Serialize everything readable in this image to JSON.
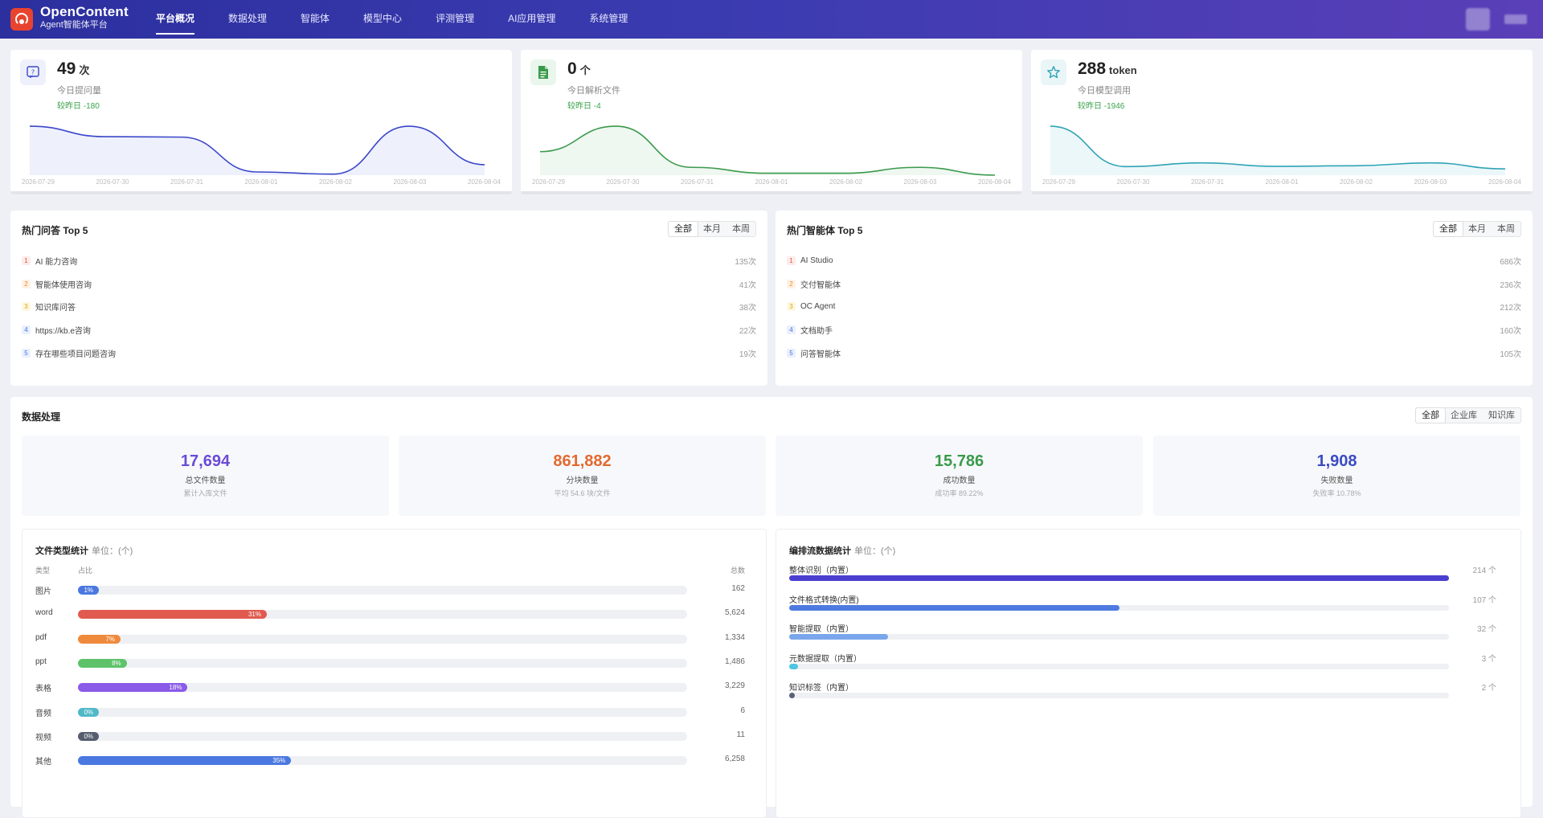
{
  "brand": {
    "title": "OpenContent",
    "subtitle": "Agent智能体平台"
  },
  "nav": [
    {
      "label": "平台概况",
      "active": true
    },
    {
      "label": "数据处理"
    },
    {
      "label": "智能体"
    },
    {
      "label": "模型中心"
    },
    {
      "label": "评测管理"
    },
    {
      "label": "AI应用管理"
    },
    {
      "label": "系统管理"
    }
  ],
  "stats": [
    {
      "value": "49",
      "unit": "次",
      "label": "今日提问量",
      "delta": "较昨日 -180",
      "icon": "question-chat-icon",
      "color": "#3b47c9",
      "fill": "#eef0fc",
      "icon_bg": "#eef0fb",
      "dates": [
        "2026-07-29",
        "2026-07-30",
        "2026-07-31",
        "2026-08-01",
        "2026-08-02",
        "2026-08-03",
        "2026-08-04"
      ],
      "values": [
        229,
        180,
        178,
        15,
        5,
        229,
        49
      ]
    },
    {
      "value": "0",
      "unit": "个",
      "label": "今日解析文件",
      "delta": "较昨日 -4",
      "icon": "document-icon",
      "color": "#3a9a4c",
      "fill": "#eef7f0",
      "icon_bg": "#e9f6ec",
      "dates": [
        "2026-07-29",
        "2026-07-30",
        "2026-07-31",
        "2026-08-01",
        "2026-08-02",
        "2026-08-03",
        "2026-08-04"
      ],
      "values": [
        12,
        25,
        4,
        1,
        1,
        4,
        0
      ]
    },
    {
      "value": "288",
      "unit": "token",
      "label": "今日模型调用",
      "delta": "较昨日 -1946",
      "icon": "star-icon",
      "color": "#2fa3b5",
      "fill": "#ecf7f9",
      "icon_bg": "#eaf5f8",
      "dates": [
        "2026-07-29",
        "2026-07-30",
        "2026-07-31",
        "2026-08-01",
        "2026-08-02",
        "2026-08-03",
        "2026-08-04"
      ],
      "values": [
        2234,
        390,
        560,
        400,
        430,
        560,
        288
      ]
    }
  ],
  "hot_qa": {
    "title": "热门问答 Top 5",
    "tabs": [
      "全部",
      "本月",
      "本周"
    ],
    "items": [
      {
        "rank": "1",
        "name": "AI 能力咨询",
        "count": "135次"
      },
      {
        "rank": "2",
        "name": "智能体使用咨询",
        "count": "41次"
      },
      {
        "rank": "3",
        "name": "知识库问答",
        "count": "38次"
      },
      {
        "rank": "4",
        "name": "https://kb.e咨询",
        "count": "22次"
      },
      {
        "rank": "5",
        "name": "存在哪些项目问题咨询",
        "count": "19次"
      }
    ]
  },
  "hot_agents": {
    "title": "热门智能体 Top 5",
    "tabs": [
      "全部",
      "本月",
      "本周"
    ],
    "items": [
      {
        "rank": "1",
        "name": "AI Studio",
        "count": "686次"
      },
      {
        "rank": "2",
        "name": "交付智能体",
        "count": "236次"
      },
      {
        "rank": "3",
        "name": "OC Agent",
        "count": "212次"
      },
      {
        "rank": "4",
        "name": "文档助手",
        "count": "160次"
      },
      {
        "rank": "5",
        "name": "问答智能体",
        "count": "105次"
      }
    ]
  },
  "rank_colors": {
    "1": [
      "#fdecea",
      "#e0533d"
    ],
    "2": [
      "#fff2e5",
      "#ef8a2a"
    ],
    "3": [
      "#fff8e0",
      "#d9a514"
    ],
    "4": [
      "#eaf0fd",
      "#4a6fdc"
    ],
    "5": [
      "#eaf0fd",
      "#4a6fdc"
    ]
  },
  "data_processing": {
    "title": "数据处理",
    "tabs": [
      "全部",
      "企业库",
      "知识库"
    ],
    "kpis": [
      {
        "value": "17,694",
        "label": "总文件数量",
        "sub": "累计入库文件",
        "color": "#6a4bd6"
      },
      {
        "value": "861,882",
        "label": "分块数量",
        "sub": "平均 54.6 块/文件",
        "color": "#e36a2f"
      },
      {
        "value": "15,786",
        "label": "成功数量",
        "sub": "成功率 89.22%",
        "color": "#3a9a4c"
      },
      {
        "value": "1,908",
        "label": "失败数量",
        "sub": "失败率 10.78%",
        "color": "#3b4bc2"
      }
    ],
    "file_types": {
      "title": "文件类型统计",
      "unit": "单位：(个)",
      "headers": [
        "类型",
        "占比",
        "总数"
      ],
      "rows": [
        {
          "type": "图片",
          "pct": "1%",
          "ratio": 0.01,
          "total": "162",
          "color": "#4a78e0"
        },
        {
          "type": "word",
          "pct": "31%",
          "ratio": 0.31,
          "total": "5,624",
          "color": "#e05a4f"
        },
        {
          "type": "pdf",
          "pct": "7%",
          "ratio": 0.07,
          "total": "1,334",
          "color": "#ef8a3c"
        },
        {
          "type": "ppt",
          "pct": "8%",
          "ratio": 0.08,
          "total": "1,486",
          "color": "#5ec26a"
        },
        {
          "type": "表格",
          "pct": "18%",
          "ratio": 0.18,
          "total": "3,229",
          "color": "#8a5ae8"
        },
        {
          "type": "音频",
          "pct": "0%",
          "ratio": 0.0,
          "total": "6",
          "color": "#4fb9c8"
        },
        {
          "type": "视频",
          "pct": "0%",
          "ratio": 0.0,
          "total": "11",
          "color": "#555e6e"
        },
        {
          "type": "其他",
          "pct": "35%",
          "ratio": 0.35,
          "total": "6,258",
          "color": "#4a78e0"
        }
      ]
    },
    "flows": {
      "title": "编排流数据统计",
      "unit": "单位：(个)",
      "rows": [
        {
          "name": "整体识别（内置）",
          "count": "214 个",
          "ratio": 1.0,
          "color": "#4b3fd0"
        },
        {
          "name": "文件格式转换(内置)",
          "count": "107 个",
          "ratio": 0.5,
          "color": "#4f7be0"
        },
        {
          "name": "智能提取（内置）",
          "count": "32 个",
          "ratio": 0.15,
          "color": "#7aa6ec"
        },
        {
          "name": "元数据提取（内置）",
          "count": "3 个",
          "ratio": 0.014,
          "color": "#4fc6e0"
        },
        {
          "name": "知识标签（内置）",
          "count": "2 个",
          "ratio": 0.009,
          "color": "#5a6178"
        }
      ]
    }
  }
}
